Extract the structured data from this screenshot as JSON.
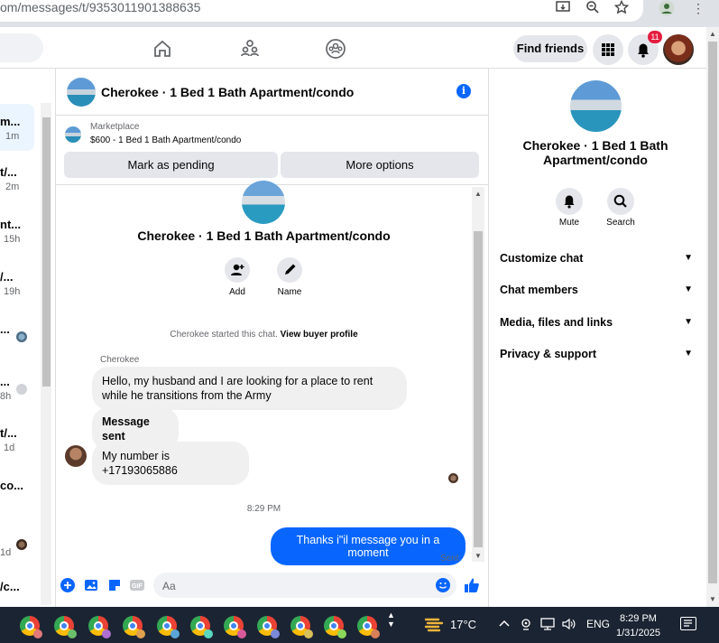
{
  "browser": {
    "url": "om/messages/t/9353011901388635"
  },
  "header": {
    "find_friends_label": "Find friends",
    "notification_count": "11"
  },
  "sidebar": {
    "items": [
      {
        "title": "m...",
        "sub": "1m"
      },
      {
        "title": "t/...",
        "sub": "2m"
      },
      {
        "title": "nt...",
        "sub": "15h"
      },
      {
        "title": "/...",
        "sub": "19h"
      },
      {
        "title": "...",
        "sub": ""
      },
      {
        "title": "...",
        "sub": "8h"
      },
      {
        "title": "t/...",
        "sub": "1d"
      },
      {
        "title": "co...",
        "sub": ""
      },
      {
        "title": "...",
        "sub": "1d"
      },
      {
        "title": "/c...",
        "sub": ""
      }
    ]
  },
  "chat": {
    "title": "Cherokee · 1 Bed 1 Bath Apartment/condo",
    "marketplace_label": "Marketplace",
    "listing": "$600 - 1 Bed 1 Bath Apartment/condo",
    "mark_pending_label": "Mark as pending",
    "more_options_label": "More options",
    "add_label": "Add",
    "name_label": "Name",
    "started_text": "Cherokee started this chat.",
    "view_profile_label": "View buyer profile",
    "sender_name": "Cherokee",
    "messages": [
      "Hello, my husband and I are looking for a place to rent while he transitions from the Army",
      "Message sent",
      "My number is +17193065886"
    ],
    "timestamp": "8:29 PM",
    "outgoing": "Thanks i\"il message you in a moment",
    "sent_label": "Sent",
    "composer_placeholder": "Aa"
  },
  "details": {
    "title": "Cherokee · 1 Bed 1 Bath Apartment/condo",
    "mute_label": "Mute",
    "search_label": "Search",
    "rows": [
      "Customize chat",
      "Chat members",
      "Media, files and links",
      "Privacy & support"
    ]
  },
  "taskbar": {
    "temperature": "17°C",
    "language": "ENG",
    "time": "8:29 PM",
    "date": "1/31/2025"
  }
}
